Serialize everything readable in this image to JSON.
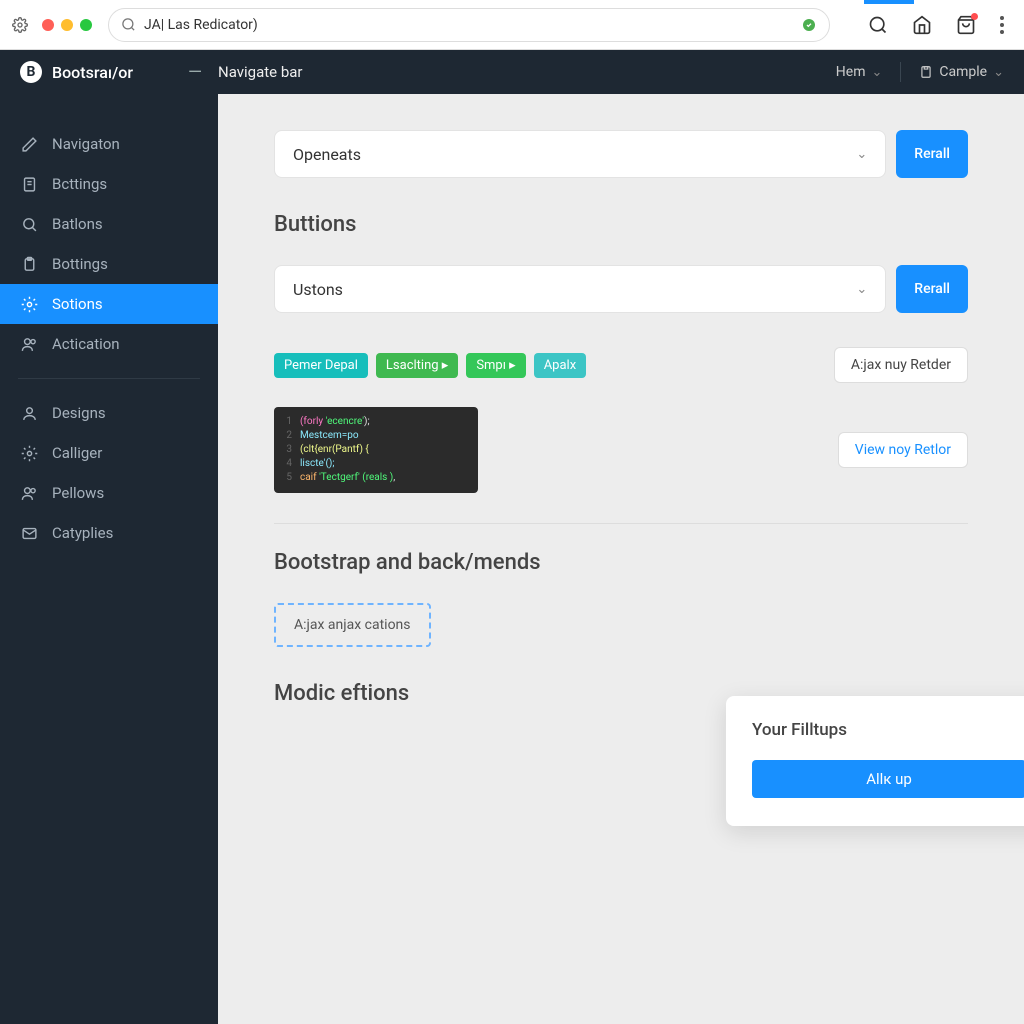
{
  "browser": {
    "url_value": "JA| Las Redicator)"
  },
  "header": {
    "brand": "Bootsraı/or",
    "title": "Navigate bar",
    "right": {
      "item1": "Hem",
      "item2": "Cample"
    }
  },
  "sidebar": {
    "items": [
      {
        "label": "Navigaton",
        "icon": "pencil"
      },
      {
        "label": "Bcttings",
        "icon": "doc"
      },
      {
        "label": "Batlons",
        "icon": "search"
      },
      {
        "label": "Bottings",
        "icon": "clipboard"
      },
      {
        "label": "Sotions",
        "icon": "gear"
      },
      {
        "label": "Actication",
        "icon": "users"
      }
    ],
    "items2": [
      {
        "label": "Designs",
        "icon": "user"
      },
      {
        "label": "Calliger",
        "icon": "gear"
      },
      {
        "label": "Pellows",
        "icon": "users"
      },
      {
        "label": "Catyplies",
        "icon": "mail"
      }
    ]
  },
  "main": {
    "select1": {
      "label": "Openeats",
      "btn": "Rerall"
    },
    "section_buttons": "Buttions",
    "select2": {
      "label": "Ustons",
      "btn": "Rerall"
    },
    "tags": [
      "Pemer Depal",
      "Lsaclting ▸",
      "Smpı ▸",
      "Apalx"
    ],
    "ajax_btn": "A:jax nuy Retder",
    "view_btn": "View noy Retlor",
    "code": [
      {
        "n": "1",
        "t1": "(forly",
        "t2": "'ecencre'",
        "t3": ");"
      },
      {
        "n": "2",
        "t1": "  Mestcem=po"
      },
      {
        "n": "3",
        "t1": "   (clt{enr(Pantf) {"
      },
      {
        "n": "4",
        "t1": "    liscte'();"
      },
      {
        "n": "5",
        "t1": "   caif ",
        "t2": "'Tectgerf' (reals )",
        "t3": ","
      }
    ],
    "section_bootstrap": "Bootstrap and back/mends",
    "dashed_label": "A:jax anjax cations",
    "section_modic": "Modic eftions",
    "card": {
      "title": "Your Filltups",
      "btn": "Allк up"
    }
  }
}
